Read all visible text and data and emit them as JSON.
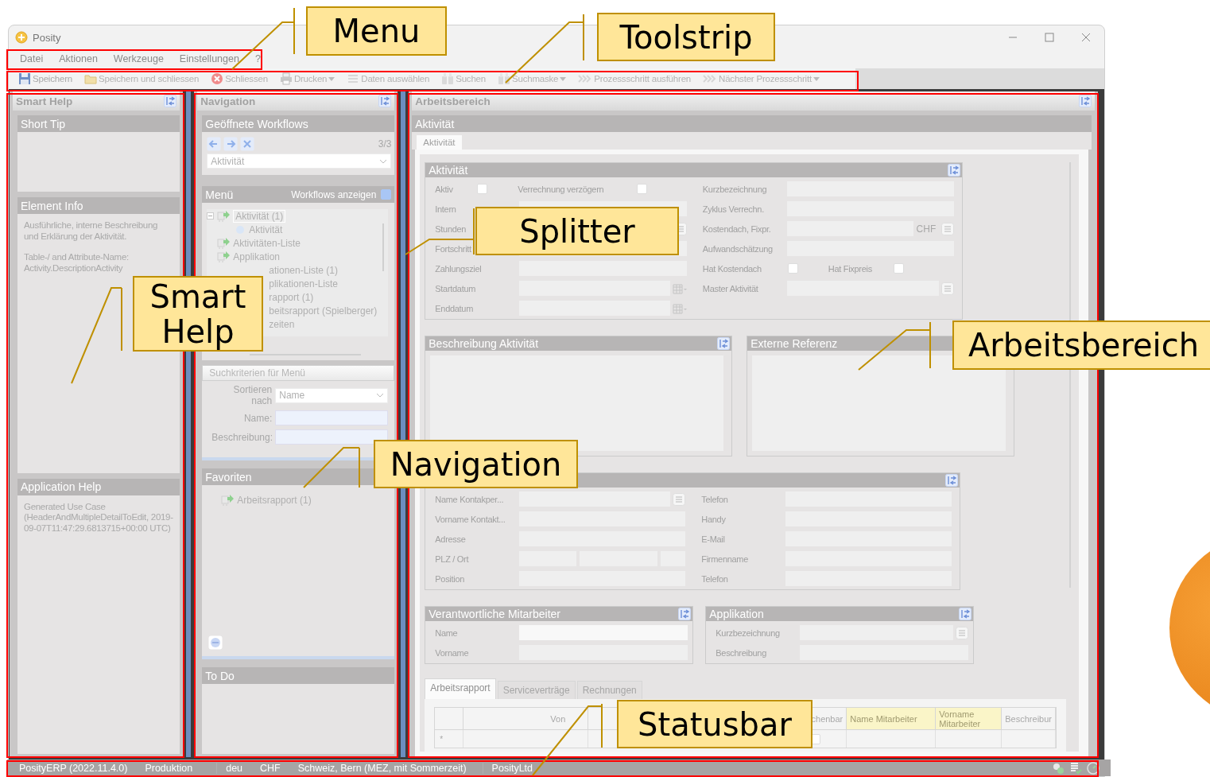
{
  "window": {
    "title": "Posity"
  },
  "menu": [
    "Datei",
    "Aktionen",
    "Werkzeuge",
    "Einstellungen",
    "?"
  ],
  "toolstrip": [
    {
      "label": "Speichern",
      "kind": "save",
      "dropdown": false
    },
    {
      "label": "Speichern und schliessen",
      "kind": "save-close",
      "dropdown": false
    },
    {
      "label": "Schliessen",
      "kind": "close",
      "dropdown": false
    },
    {
      "label": "Drucken",
      "kind": "print",
      "dropdown": true
    },
    {
      "label": "Daten auswählen",
      "kind": "select",
      "dropdown": false
    },
    {
      "label": "Suchen",
      "kind": "search",
      "dropdown": false
    },
    {
      "label": "Suchmaske",
      "kind": "search",
      "dropdown": true
    },
    {
      "label": "Prozessschritt ausführen",
      "kind": "step",
      "dropdown": false
    },
    {
      "label": "Nächster Prozessschritt",
      "kind": "step",
      "dropdown": true
    }
  ],
  "smart_help": {
    "title": "Smart Help",
    "sections": [
      {
        "title": "Short Tip"
      },
      {
        "title": "Element Info",
        "paragraphs": [
          "Ausführliche, interne Beschreibung und Erklärung der Aktivität.",
          "Table-/ and Attribute-Name: Activity.DescriptionActivity"
        ]
      },
      {
        "title": "Application Help",
        "paragraphs": [
          "Generated Use Case (HeaderAndMultipleDetailToEdit, 2019-09-07T11:47:29.6813715+00:00 UTC)"
        ]
      }
    ]
  },
  "navigation": {
    "title": "Navigation",
    "workflows": {
      "title": "Geöffnete Workflows",
      "counter": "3/3",
      "value": "Aktivität"
    },
    "menu": {
      "title": "Menü",
      "toggle_label": "Workflows anzeigen",
      "checked": true,
      "tree": [
        {
          "label": "Aktivität (1)",
          "kind": "workflow",
          "selected": true,
          "expanded": true,
          "children": [
            {
              "label": "Aktivität",
              "kind": "form",
              "selected": false
            }
          ]
        },
        {
          "label": "Aktivitäten-Liste",
          "kind": "workflow",
          "selected": false
        },
        {
          "label": "Applikation",
          "kind": "workflow",
          "selected": false
        },
        {
          "label": "ationen-Liste (1)",
          "kind": "covered",
          "selected": false
        },
        {
          "label": "plikationen-Liste",
          "kind": "covered",
          "selected": false
        },
        {
          "label": "rapport (1)",
          "kind": "covered",
          "selected": false
        },
        {
          "label": "beitsrapport (Spielberger)",
          "kind": "covered",
          "selected": false
        },
        {
          "label": "zeiten",
          "kind": "covered",
          "selected": false
        }
      ]
    },
    "search": {
      "title": "Suchkriterien für Menü",
      "fields": [
        {
          "label": "Sortieren nach",
          "kind": "combo",
          "value": "Name"
        },
        {
          "label": "Name:",
          "kind": "text"
        },
        {
          "label": "Beschreibung:",
          "kind": "text"
        }
      ]
    },
    "favorites": {
      "title": "Favoriten",
      "items": [
        "Arbeitsrapport (1)"
      ]
    },
    "todo": {
      "title": "To Do"
    }
  },
  "workspace": {
    "title": "Arbeitsbereich",
    "form_title": "Aktivität",
    "tabs": [
      {
        "label": "Aktivität",
        "selected": true
      }
    ],
    "main_group": {
      "title": "Aktivität",
      "rows": [
        {
          "left": [
            {
              "label": "Aktiv",
              "kind": "checkbox",
              "checked": false
            },
            {
              "label": "Verrechnung verzögern",
              "kind": "checkbox",
              "checked": false
            }
          ],
          "right": [
            {
              "label": "Kurzbezeichnung",
              "kind": "text"
            }
          ]
        },
        {
          "left": [
            {
              "label": "Intern",
              "kind": "text"
            }
          ],
          "right": [
            {
              "label": "Zyklus Verrechn.",
              "kind": "text"
            }
          ]
        },
        {
          "left": [
            {
              "label": "Stunden",
              "kind": "list"
            }
          ],
          "right": [
            {
              "label": "Kostendach, Fixpr.",
              "kind": "currency",
              "unit": "CHF"
            }
          ]
        },
        {
          "left": [
            {
              "label": "Fortschritt",
              "kind": "text"
            }
          ],
          "right": [
            {
              "label": "Aufwandschätzung",
              "kind": "text"
            }
          ]
        },
        {
          "left": [
            {
              "label": "Zahlungsziel",
              "kind": "text"
            }
          ],
          "right": [
            {
              "label": "Hat Kostendach",
              "kind": "checkbox",
              "checked": false
            },
            {
              "label": "Hat Fixpreis",
              "kind": "checkbox",
              "checked": false
            }
          ]
        },
        {
          "left": [
            {
              "label": "Startdatum",
              "kind": "date"
            }
          ],
          "right": [
            {
              "label": "Master Aktivität",
              "kind": "list"
            }
          ]
        },
        {
          "left": [
            {
              "label": "Enddatum",
              "kind": "date"
            }
          ],
          "right": []
        }
      ]
    },
    "text_groups": [
      {
        "title": "Beschreibung Aktivität"
      },
      {
        "title": "Externe Referenz"
      }
    ],
    "contact_group": {
      "rows": [
        {
          "left": [
            {
              "label": "Name Kontakper...",
              "kind": "list"
            }
          ],
          "right": [
            {
              "label": "Telefon",
              "kind": "text"
            }
          ]
        },
        {
          "left": [
            {
              "label": "Vorname Kontakt...",
              "kind": "text"
            }
          ],
          "right": [
            {
              "label": "Handy",
              "kind": "text"
            }
          ]
        },
        {
          "left": [
            {
              "label": "Adresse",
              "kind": "text"
            }
          ],
          "right": [
            {
              "label": "E-Mail",
              "kind": "text"
            }
          ]
        },
        {
          "left": [
            {
              "label": "PLZ / Ort",
              "kind": "plz"
            }
          ],
          "right": [
            {
              "label": "Firmenname",
              "kind": "text"
            }
          ]
        },
        {
          "left": [
            {
              "label": "Position",
              "kind": "text"
            }
          ],
          "right": [
            {
              "label": "Telefon",
              "kind": "text"
            }
          ]
        }
      ]
    },
    "small_groups": [
      {
        "title": "Verantwortliche Mitarbeiter",
        "rows": [
          {
            "left": [
              {
                "label": "Name",
                "kind": "combo"
              }
            ],
            "right": []
          },
          {
            "left": [
              {
                "label": "Vorname",
                "kind": "text"
              }
            ],
            "right": []
          }
        ]
      },
      {
        "title": "Applikation",
        "rows": [
          {
            "left": [
              {
                "label": "Kurzbezeichnung",
                "kind": "list"
              }
            ],
            "right": []
          },
          {
            "left": [
              {
                "label": "Beschreibung",
                "kind": "text"
              }
            ],
            "right": []
          }
        ]
      }
    ],
    "detail_tabs": [
      {
        "label": "Arbeitsrapport",
        "selected": true
      },
      {
        "label": "Serviceverträge",
        "selected": false
      },
      {
        "label": "Rechnungen",
        "selected": false
      }
    ],
    "table": {
      "columns": [
        {
          "label": "Von",
          "required": false
        },
        {
          "label": "chenbar",
          "required": false
        },
        {
          "label": "Name Mitarbeiter",
          "required": true
        },
        {
          "label": "Vorname Mitarbeiter",
          "required": true
        },
        {
          "label": "Beschreibur",
          "required": false
        }
      ],
      "rows": [
        {
          "marker": "*",
          "checked": false
        }
      ]
    }
  },
  "status_bar": [
    "PosityERP (2022.11.4.0)",
    "Produktion",
    "deu",
    "CHF",
    "Schweiz, Bern (MEZ, mit Sommerzeit)",
    "PosityLtd"
  ],
  "annotations": [
    {
      "label": "Menu"
    },
    {
      "label": "Toolstrip"
    },
    {
      "label": "Splitter"
    },
    {
      "label": "Smart Help"
    },
    {
      "label": "Navigation"
    },
    {
      "label": "Arbeitsbereich"
    },
    {
      "label": "Statusbar"
    }
  ]
}
